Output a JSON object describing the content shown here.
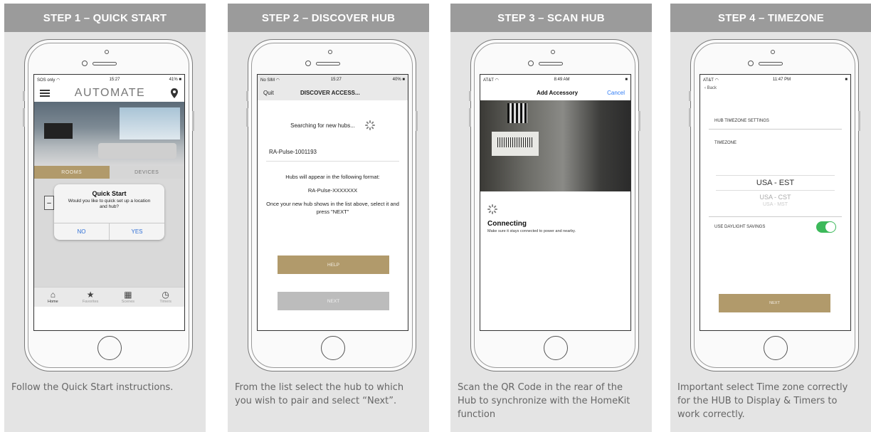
{
  "steps": [
    {
      "header": "STEP 1 – QUICK START",
      "caption": "Follow the Quick Start instructions.",
      "status": {
        "left": "SOS only ◠",
        "time": "15:27",
        "right": "41% ■"
      },
      "app_logo": "AUTOMATE",
      "tabs": {
        "rooms": "ROOMS",
        "devices": "DEVICES"
      },
      "dialog": {
        "title": "Quick Start",
        "message": "Would you like to quick set up a location and hub?",
        "no": "NO",
        "yes": "YES"
      },
      "tabbar": [
        {
          "label": "Home",
          "icon": "home-icon"
        },
        {
          "label": "Favorites",
          "icon": "star-icon"
        },
        {
          "label": "Scenes",
          "icon": "film-icon"
        },
        {
          "label": "Timers",
          "icon": "clock-icon"
        }
      ]
    },
    {
      "header": "STEP 2 – DISCOVER HUB",
      "caption": "From the list select the hub to which you wish to pair and select “Next”.",
      "status": {
        "left": "No SIM ◠",
        "time": "15:27",
        "right": "40% ■"
      },
      "nav": {
        "quit": "Quit",
        "title": "DISCOVER ACCESS..."
      },
      "searching": "Searching for new hubs...",
      "hub": "RA-Pulse-1001193",
      "info": "Hubs will appear in the following format:",
      "format": "RA-Pulse-XXXXXXX",
      "note": "Once your new hub shows in the list above, select it and press \"NEXT\"",
      "help": "HELP",
      "next": "NEXT"
    },
    {
      "header": "STEP 3 – SCAN HUB",
      "caption": "Scan the QR Code in the rear of the Hub to synchronize with the HomeKit function",
      "status": {
        "left": "AT&T ◠",
        "time": "8:49 AM",
        "right": "■"
      },
      "nav": {
        "title": "Add Accessory",
        "cancel": "Cancel"
      },
      "connecting": "Connecting",
      "message": "Make sure it stays connected to power and nearby."
    },
    {
      "header": "STEP 4 – TIMEZONE",
      "caption": "Important select Time zone correctly for the HUB to Display & Timers to work correctly.",
      "status": {
        "left": "AT&T ◠",
        "time": "11:47 PM",
        "right": "■"
      },
      "back": "Back",
      "settings_label": "HUB TIMEZONE SETTINGS",
      "timezone_label": "TIMEZONE",
      "picker": {
        "selected": "USA - EST",
        "option1": "USA - CST",
        "option2": "USA - MST"
      },
      "dst_label": "USE DAYLIGHT SAVINGS",
      "dst_on": true,
      "next": "NEXT"
    }
  ],
  "colors": {
    "header": "#9b9b9b",
    "gold": "#b19a6b",
    "toggle": "#3cb95a",
    "link": "#2f7cf6"
  }
}
